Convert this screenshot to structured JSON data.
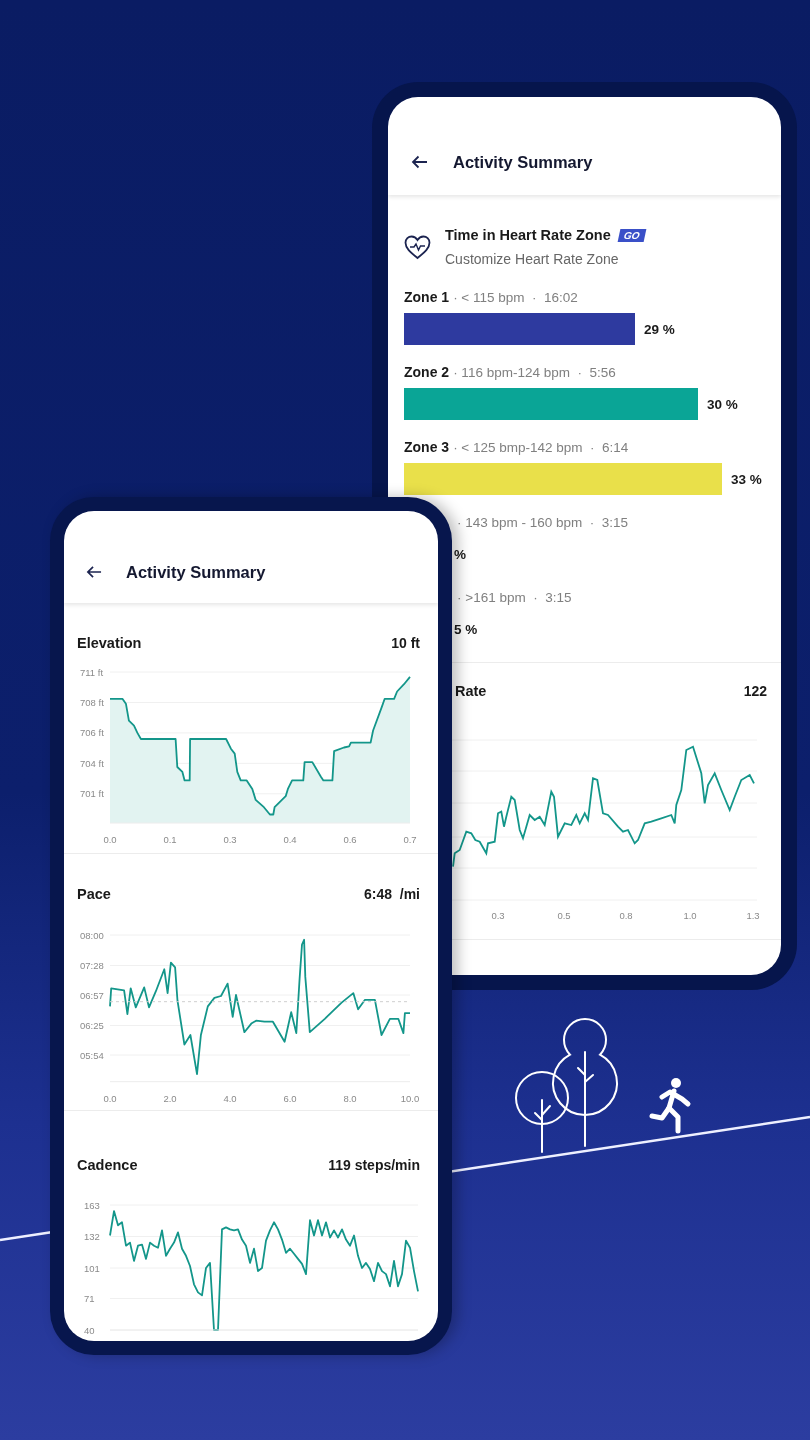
{
  "back_phone": {
    "header": {
      "title": "Activity Summary"
    },
    "heart_rate_zone": {
      "title": "Time in Heart Rate Zone",
      "badge": "GO",
      "subtitle": "Customize Heart Rate Zone"
    },
    "zones": [
      {
        "label": "Zone 1",
        "detail": "· < 115 bpm  ·  16:02",
        "color": "#2e3a9f",
        "percent": "29 %"
      },
      {
        "label": "Zone 2",
        "detail": "· 116 bpm-124 bpm  ·  5:56",
        "color": "#0aa596",
        "percent": "30 %"
      },
      {
        "label": "Zone 3",
        "detail": "· < 125 bmp-142 bpm  ·  6:14",
        "color": "#e9e04a",
        "percent": "33 %"
      },
      {
        "detail": "· 143 bpm - 160 bpm  ·  3:15",
        "percent": "%"
      },
      {
        "detail": "· >161 bpm  ·  3:15",
        "percent": "5 %"
      }
    ],
    "heart_rate": {
      "title": "Rate",
      "value": "122",
      "x_labels": [
        "0.3",
        "0.5",
        "0.8",
        "1.0",
        "1.3"
      ]
    }
  },
  "front_phone": {
    "header": {
      "title": "Activity Summary"
    },
    "sections": [
      {
        "title": "Elevation",
        "value": "10 ft",
        "chart_data": {
          "type": "area",
          "xlim": [
            0,
            0.7
          ],
          "ylim": [
            698.6,
            711
          ],
          "grid": true,
          "x": [
            0,
            0.029,
            0.037,
            0.044,
            0.056,
            0.064,
            0.072,
            0.153,
            0.157,
            0.169,
            0.174,
            0.186,
            0.187,
            0.271,
            0.282,
            0.291,
            0.297,
            0.305,
            0.319,
            0.332,
            0.34,
            0.359,
            0.373,
            0.381,
            0.384,
            0.41,
            0.415,
            0.425,
            0.451,
            0.454,
            0.472,
            0.492,
            0.498,
            0.519,
            0.523,
            0.546,
            0.558,
            0.562,
            0.608,
            0.614,
            0.635,
            0.641,
            0.663,
            0.67,
            0.686,
            0.7
          ],
          "series": [
            {
              "color": "#13968a",
              "values": [
                708.8,
                708.8,
                708.4,
                707,
                706.6,
                706,
                705.5,
                705.5,
                703.2,
                702.8,
                702.1,
                702.1,
                705.5,
                705.5,
                704.7,
                704.3,
                702.8,
                702.1,
                702.1,
                701.4,
                700.5,
                699.9,
                699.3,
                699.3,
                699.9,
                700.8,
                701.4,
                702.1,
                702.1,
                703.6,
                703.6,
                702.4,
                702.1,
                702.1,
                704.5,
                704.8,
                704.9,
                705.2,
                705.2,
                706.2,
                708.2,
                708.8,
                708.8,
                709.4,
                710,
                710.6
              ]
            }
          ],
          "xticks": [
            {
              "value": 0,
              "label": "0.0"
            },
            {
              "value": 0.14,
              "label": "0.1"
            },
            {
              "value": 0.28,
              "label": "0.3"
            },
            {
              "value": 0.42,
              "label": "0.4"
            },
            {
              "value": 0.56,
              "label": "0.6"
            },
            {
              "value": 0.7,
              "label": "0.7"
            }
          ],
          "yticks": [
            {
              "value": 711,
              "label": "711 ft"
            },
            {
              "value": 708.5,
              "label": "708 ft"
            },
            {
              "value": 706,
              "label": "706 ft"
            },
            {
              "value": 703.5,
              "label": "704 ft"
            },
            {
              "value": 701,
              "label": "701 ft"
            }
          ]
        }
      },
      {
        "title": "Pace",
        "value": "6:48  /mi",
        "chart_data": {
          "type": "line",
          "xlim": [
            0,
            10
          ],
          "ylim": [
            326,
            480
          ],
          "grid": true,
          "x": [
            0,
            0.04,
            0.47,
            0.58,
            0.69,
            0.86,
            1.14,
            1.3,
            1.53,
            1.81,
            1.92,
            2.03,
            2.17,
            2.25,
            2.48,
            2.68,
            2.9,
            3.03,
            3.26,
            3.48,
            3.7,
            3.92,
            4.09,
            4.2,
            4.48,
            4.71,
            4.87,
            5.15,
            5.43,
            5.82,
            6.04,
            6.21,
            6.32,
            6.4,
            6.47,
            6.51,
            6.66,
            7.16,
            7.72,
            8.11,
            8.27,
            8.5,
            8.83,
            9.05,
            9.33,
            9.61,
            9.78,
            9.83,
            10
          ],
          "series": [
            {
              "color": "#13968a",
              "values": [
                405,
                424,
                422,
                397,
                424,
                404,
                425,
                404,
                421,
                444,
                419,
                451,
                446,
                411,
                365,
                375,
                334,
                375,
                405,
                414,
                416,
                429,
                394,
                417,
                378,
                387,
                390,
                389,
                389,
                368,
                399,
                377,
                434,
                470,
                475,
                436,
                378,
                392,
                409,
                419,
                402,
                412,
                412,
                375,
                392,
                392,
                377,
                398,
                398
              ]
            }
          ],
          "xticks": [
            {
              "value": 0,
              "label": "0.0"
            },
            {
              "value": 2,
              "label": "2.0"
            },
            {
              "value": 4,
              "label": "4.0"
            },
            {
              "value": 6,
              "label": "6.0"
            },
            {
              "value": 8,
              "label": "8.0"
            },
            {
              "value": 10,
              "label": "10.0"
            }
          ],
          "yticks": [
            {
              "value": 480,
              "label": "08:00"
            },
            {
              "value": 448,
              "label": "07:28"
            },
            {
              "value": 417,
              "label": "06:57"
            },
            {
              "value": 385,
              "label": "06:25"
            },
            {
              "value": 354,
              "label": "05:54"
            }
          ],
          "ref_lines": [
            {
              "axis": "y",
              "value": 410
            }
          ]
        }
      },
      {
        "title": "Cadence",
        "value": "119 steps/min",
        "chart_data": {
          "type": "line",
          "ylim": [
            40,
            163
          ],
          "grid": true,
          "series": [
            {
              "color": "#13968a",
              "values": [
                133,
                157,
                143,
                146,
                123,
                126,
                108,
                123,
                124,
                110,
                126,
                123,
                121,
                138,
                113,
                120,
                126,
                136,
                120,
                113,
                103,
                85,
                77,
                74,
                101,
                106,
                40,
                40,
                139,
                141,
                139,
                138,
                139,
                129,
                123,
                106,
                120,
                98,
                101,
                128,
                138,
                146,
                139,
                129,
                116,
                120,
                115,
                110,
                105,
                95,
                148,
                133,
                148,
                133,
                146,
                131,
                138,
                131,
                139,
                129,
                123,
                133,
                113,
                101,
                106,
                100,
                88,
                106,
                98,
                95,
                83,
                108,
                83,
                95,
                128,
                121,
                98,
                78
              ]
            }
          ],
          "yticks": [
            163,
            132,
            101,
            71,
            40
          ]
        }
      }
    ]
  }
}
